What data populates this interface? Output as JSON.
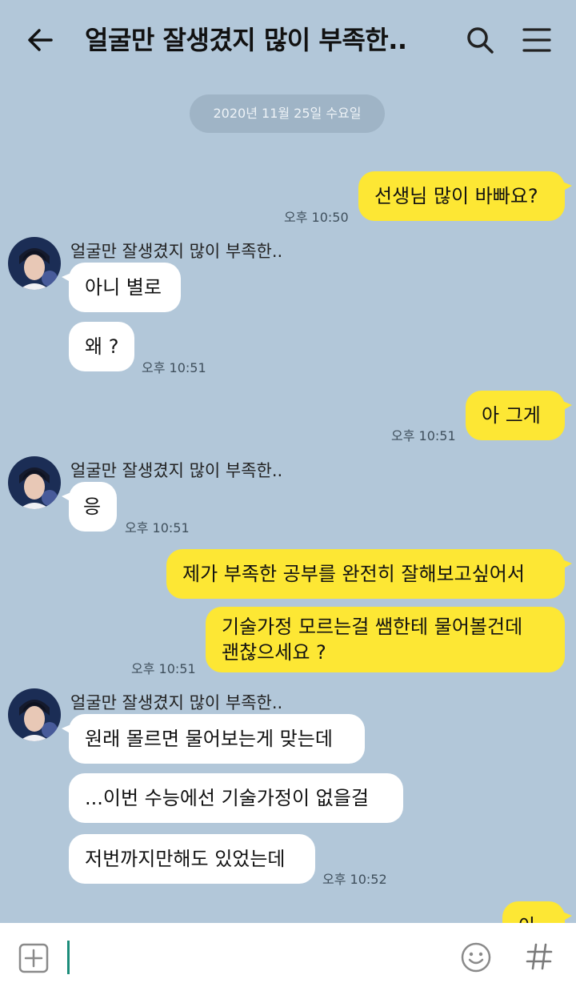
{
  "header": {
    "title": "얼굴만 잘생겼지 많이 부족한.."
  },
  "date_divider": "2020년 11월 25일 수요일",
  "messages": {
    "m1": {
      "text": "선생님 많이 바빠요?",
      "time": "오후 10:50"
    },
    "g1": {
      "sender": "얼굴만 잘생겼지 많이 부족한..",
      "b1": "아니 별로",
      "b2": "왜 ?",
      "time": "오후 10:51"
    },
    "m2": {
      "text": "아 그게",
      "time": "오후 10:51"
    },
    "g2": {
      "sender": "얼굴만 잘생겼지 많이 부족한..",
      "b1": "응",
      "time": "오후 10:51"
    },
    "m3": {
      "b1": "제가 부족한 공부를 완전히 잘해보고싶어서",
      "b2_line1": "기술가정 모르는걸 쌤한테 물어볼건데",
      "b2_line2": "괜찮으세요 ?",
      "time": "오후 10:51"
    },
    "g3": {
      "sender": "얼굴만 잘생겼지 많이 부족한..",
      "b1": "원래 몰르면 물어보는게 맞는데",
      "b2": "...이번 수능에선 기술가정이 없을걸",
      "b3": "저번까지만해도 있었는데",
      "time": "오후 10:52"
    },
    "m4": {
      "text": "아"
    }
  },
  "colors": {
    "background": "#b2c7d9",
    "my_bubble": "#fde734",
    "their_bubble": "#ffffff",
    "cursor": "#1c8c7a"
  },
  "icons": [
    "back-arrow-icon",
    "search-icon",
    "menu-icon",
    "plus-box-icon",
    "emoji-icon",
    "hash-icon"
  ]
}
